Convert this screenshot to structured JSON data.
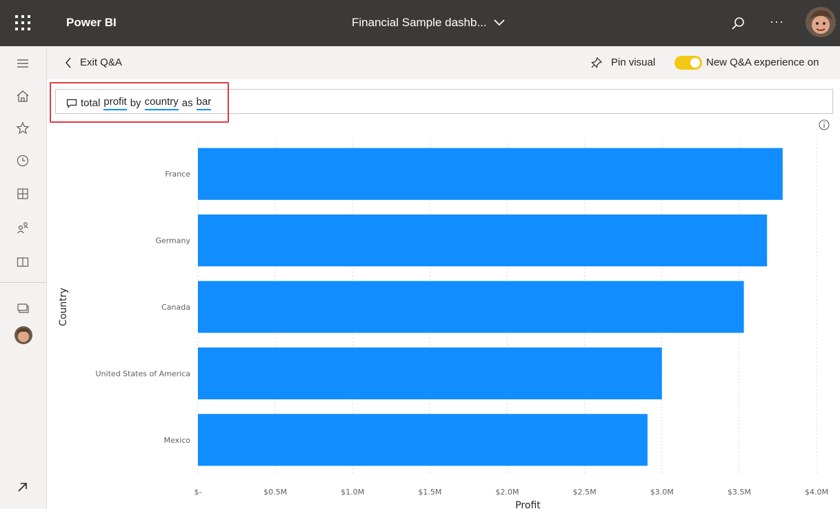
{
  "header": {
    "app_name": "Power BI",
    "report_title": "Financial Sample dashb..."
  },
  "commandbar": {
    "back_label": "Exit Q&A",
    "pin_label": "Pin visual",
    "toggle_label": "New Q&A experience on",
    "toggle_on": true
  },
  "question": {
    "words": [
      "total",
      "profit",
      "by",
      "country",
      "as",
      "bar"
    ],
    "underlined_words": [
      "profit",
      "country",
      "bar"
    ]
  },
  "colors": {
    "topbar": "#3b3a39",
    "accent_yellow": "#f2c811",
    "bar": "#118dff",
    "highlight_border": "#e03a3e"
  },
  "chart_data": {
    "type": "bar",
    "orientation": "horizontal",
    "categories": [
      "France",
      "Germany",
      "Canada",
      "United States of America",
      "Mexico"
    ],
    "values": [
      3781000,
      3680000,
      3530000,
      3000000,
      2907000
    ],
    "xlabel": "Profit",
    "ylabel": "Country",
    "xlim": [
      0,
      4000000
    ],
    "x_ticks": [
      0,
      500000,
      1000000,
      1500000,
      2000000,
      2500000,
      3000000,
      3500000,
      4000000
    ],
    "x_tick_labels": [
      "$-",
      "$0.5M",
      "$1.0M",
      "$1.5M",
      "$2.0M",
      "$2.5M",
      "$3.0M",
      "$3.5M",
      "$4.0M"
    ],
    "grid": "vertical dotted",
    "legend": "none"
  }
}
